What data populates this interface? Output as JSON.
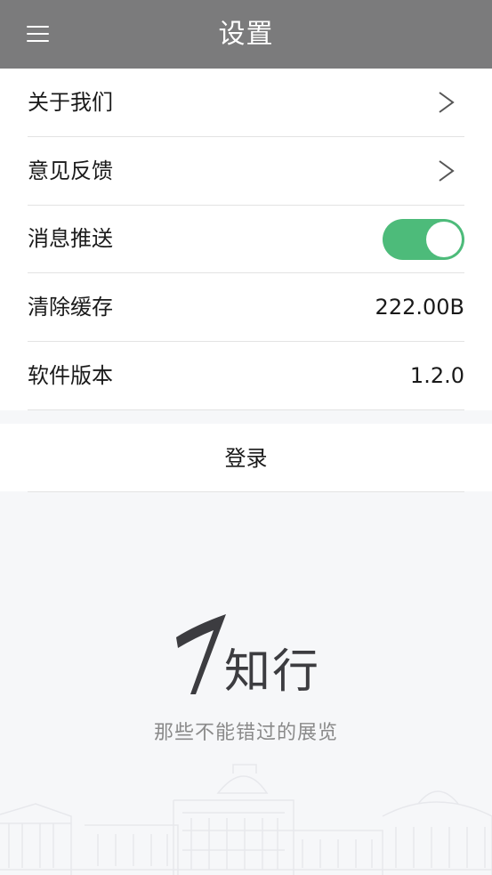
{
  "header": {
    "title": "设置",
    "menu_icon": "hamburger-menu-icon"
  },
  "settings": {
    "about_label": "关于我们",
    "feedback_label": "意见反馈",
    "push_label": "消息推送",
    "push_enabled": true,
    "cache_label": "清除缓存",
    "cache_value": "222.00B",
    "version_label": "软件版本",
    "version_value": "1.2.0",
    "chevron_icon": "chevron-right-icon"
  },
  "login": {
    "label": "登录"
  },
  "brand": {
    "name": "知行",
    "tagline": "那些不能错过的展览",
    "logo_icon": "brand-stroke-logo-icon"
  },
  "colors": {
    "header_bg": "#7b7b7c",
    "toggle_on": "#4dbb7a",
    "page_bg": "#f6f7f9",
    "card_bg": "#ffffff"
  }
}
